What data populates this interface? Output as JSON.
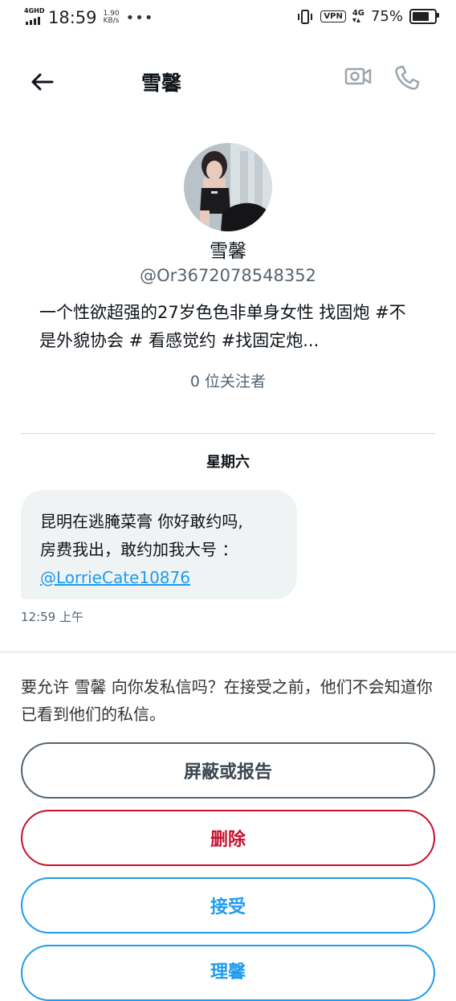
{
  "status_bar": {
    "network_tag": "4GHD",
    "time": "18:59",
    "speed_value": "1.90",
    "speed_unit": "KB/s",
    "dots": "•••",
    "vpn": "VPN",
    "network_right": "4G",
    "battery_percent": "75%",
    "battery_level": 0.75
  },
  "header": {
    "title": "雪馨"
  },
  "profile": {
    "name": "雪馨",
    "handle": "@Or3672078548352",
    "bio": "一个性欲超强的27岁色色非单身女性  找固炮 #不是外貌协会 # 看感觉约  #找固定炮...",
    "followers": "0 位关注者"
  },
  "conversation": {
    "day_label": "星期六",
    "message": {
      "line1": "昆明在逃腌菜膏 你好敢约吗,",
      "line2": "房费我出，敢约加我大号 ：",
      "link": "@LorrieCate10876",
      "time": "12:59 上午"
    }
  },
  "request": {
    "prompt": "要允许 雪馨 向你发私信吗？在接受之前，他们不会知道你已看到他们的私信。",
    "block_label": "屏蔽或报告",
    "delete_label": "删除",
    "accept_label": "接受",
    "more_label": "理馨"
  },
  "colors": {
    "accent": "#1d9bf0",
    "danger": "#c8102e",
    "muted": "#536471",
    "bubble": "#eff3f4"
  }
}
